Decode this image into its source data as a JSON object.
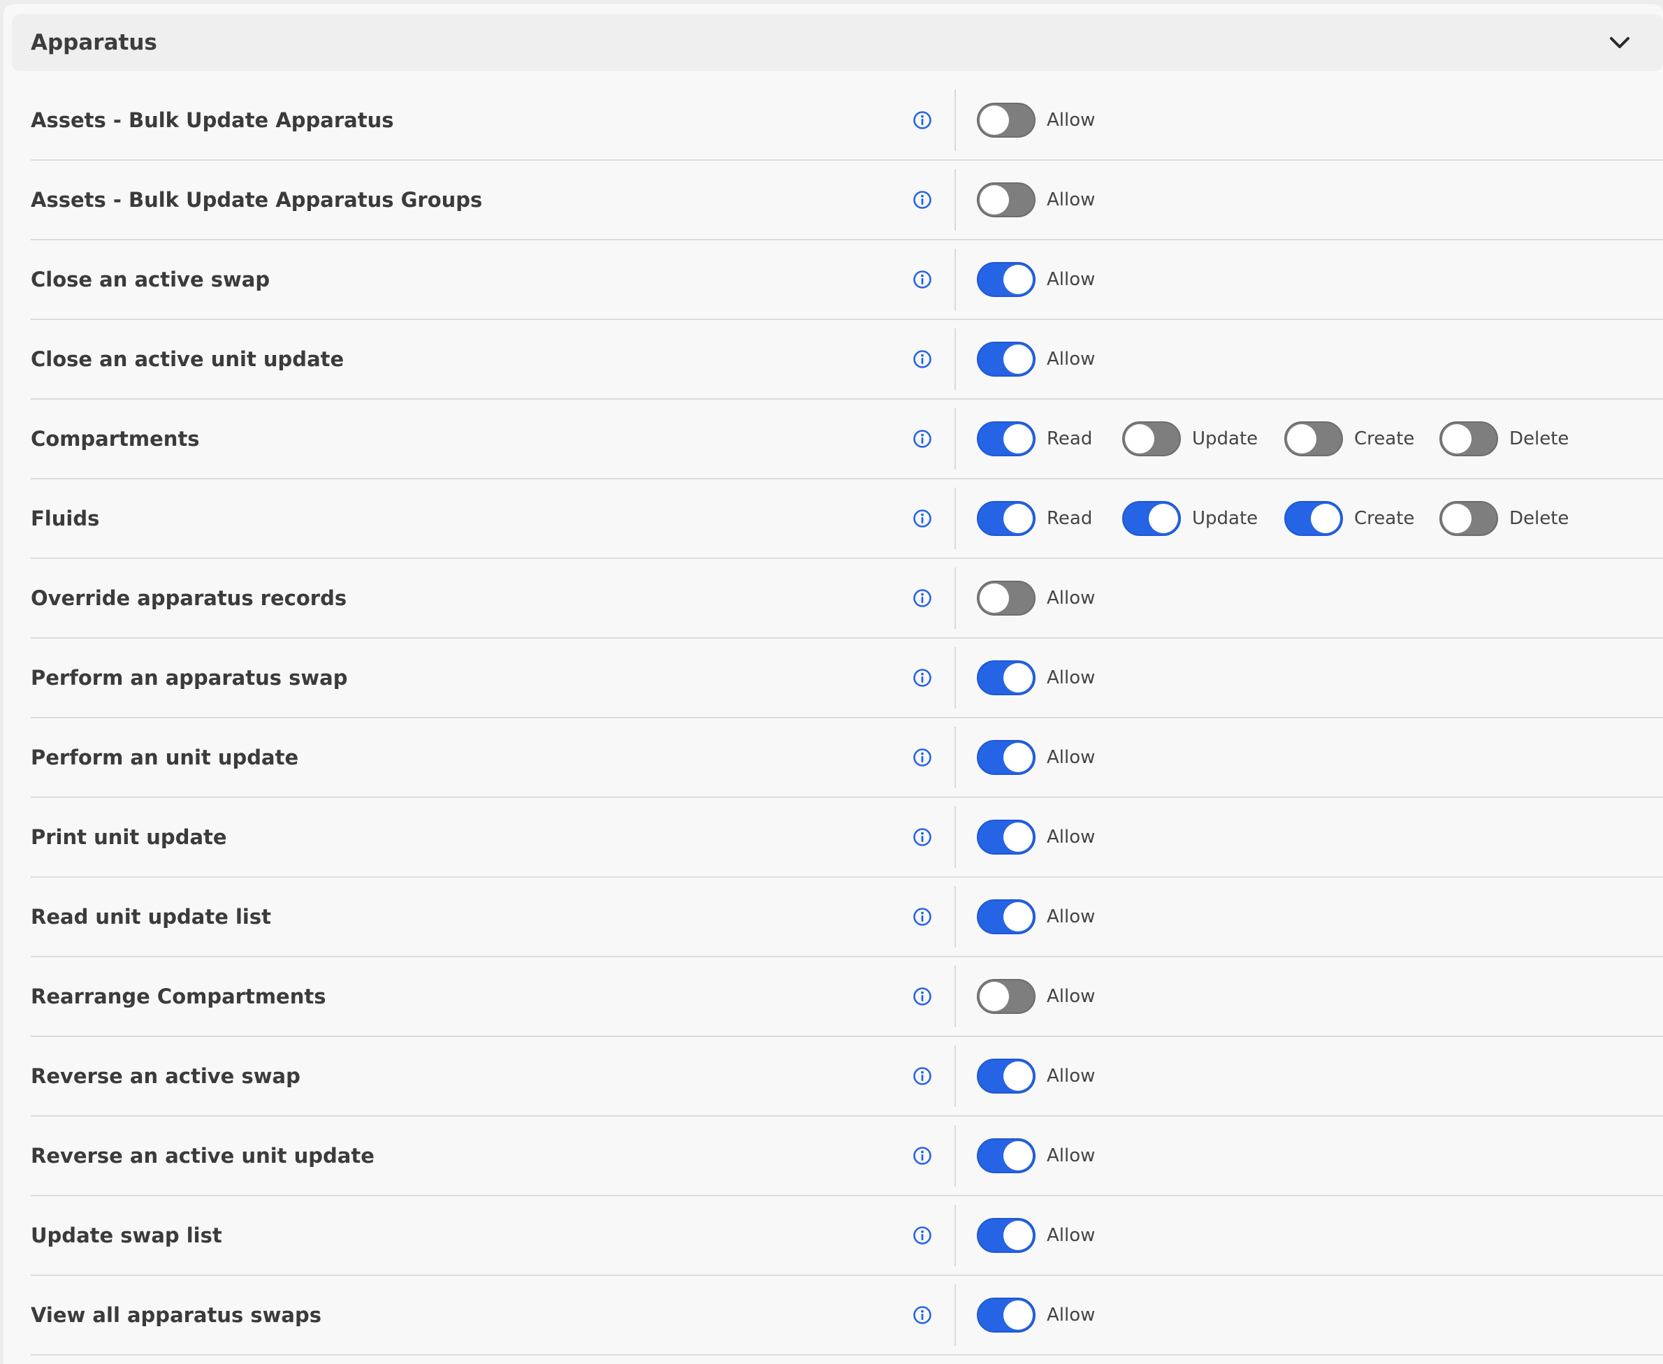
{
  "section": {
    "title": "Apparatus",
    "collapse_icon": "chevron-down-icon",
    "info_icon": "info-circle-icon",
    "toggle_on_color": "#2664e6",
    "toggle_off_color": "#7e7e7e"
  },
  "rows": [
    {
      "label": "Assets - Bulk Update Apparatus",
      "perms": [
        {
          "label": "Allow",
          "on": false
        }
      ]
    },
    {
      "label": "Assets - Bulk Update Apparatus Groups",
      "perms": [
        {
          "label": "Allow",
          "on": false
        }
      ]
    },
    {
      "label": "Close an active swap",
      "perms": [
        {
          "label": "Allow",
          "on": true
        }
      ]
    },
    {
      "label": "Close an active unit update",
      "perms": [
        {
          "label": "Allow",
          "on": true
        }
      ]
    },
    {
      "label": "Compartments",
      "perms": [
        {
          "label": "Read",
          "on": true
        },
        {
          "label": "Update",
          "on": false
        },
        {
          "label": "Create",
          "on": false
        },
        {
          "label": "Delete",
          "on": false
        }
      ]
    },
    {
      "label": "Fluids",
      "perms": [
        {
          "label": "Read",
          "on": true
        },
        {
          "label": "Update",
          "on": true
        },
        {
          "label": "Create",
          "on": true
        },
        {
          "label": "Delete",
          "on": false
        }
      ]
    },
    {
      "label": "Override apparatus records",
      "perms": [
        {
          "label": "Allow",
          "on": false
        }
      ]
    },
    {
      "label": "Perform an apparatus swap",
      "perms": [
        {
          "label": "Allow",
          "on": true
        }
      ]
    },
    {
      "label": "Perform an unit update",
      "perms": [
        {
          "label": "Allow",
          "on": true
        }
      ]
    },
    {
      "label": "Print unit update",
      "perms": [
        {
          "label": "Allow",
          "on": true
        }
      ]
    },
    {
      "label": "Read unit update list",
      "perms": [
        {
          "label": "Allow",
          "on": true
        }
      ]
    },
    {
      "label": "Rearrange Compartments",
      "perms": [
        {
          "label": "Allow",
          "on": false
        }
      ]
    },
    {
      "label": "Reverse an active swap",
      "perms": [
        {
          "label": "Allow",
          "on": true
        }
      ]
    },
    {
      "label": "Reverse an active unit update",
      "perms": [
        {
          "label": "Allow",
          "on": true
        }
      ]
    },
    {
      "label": "Update swap list",
      "perms": [
        {
          "label": "Allow",
          "on": true
        }
      ]
    },
    {
      "label": "View all apparatus swaps",
      "perms": [
        {
          "label": "Allow",
          "on": true
        }
      ]
    }
  ]
}
